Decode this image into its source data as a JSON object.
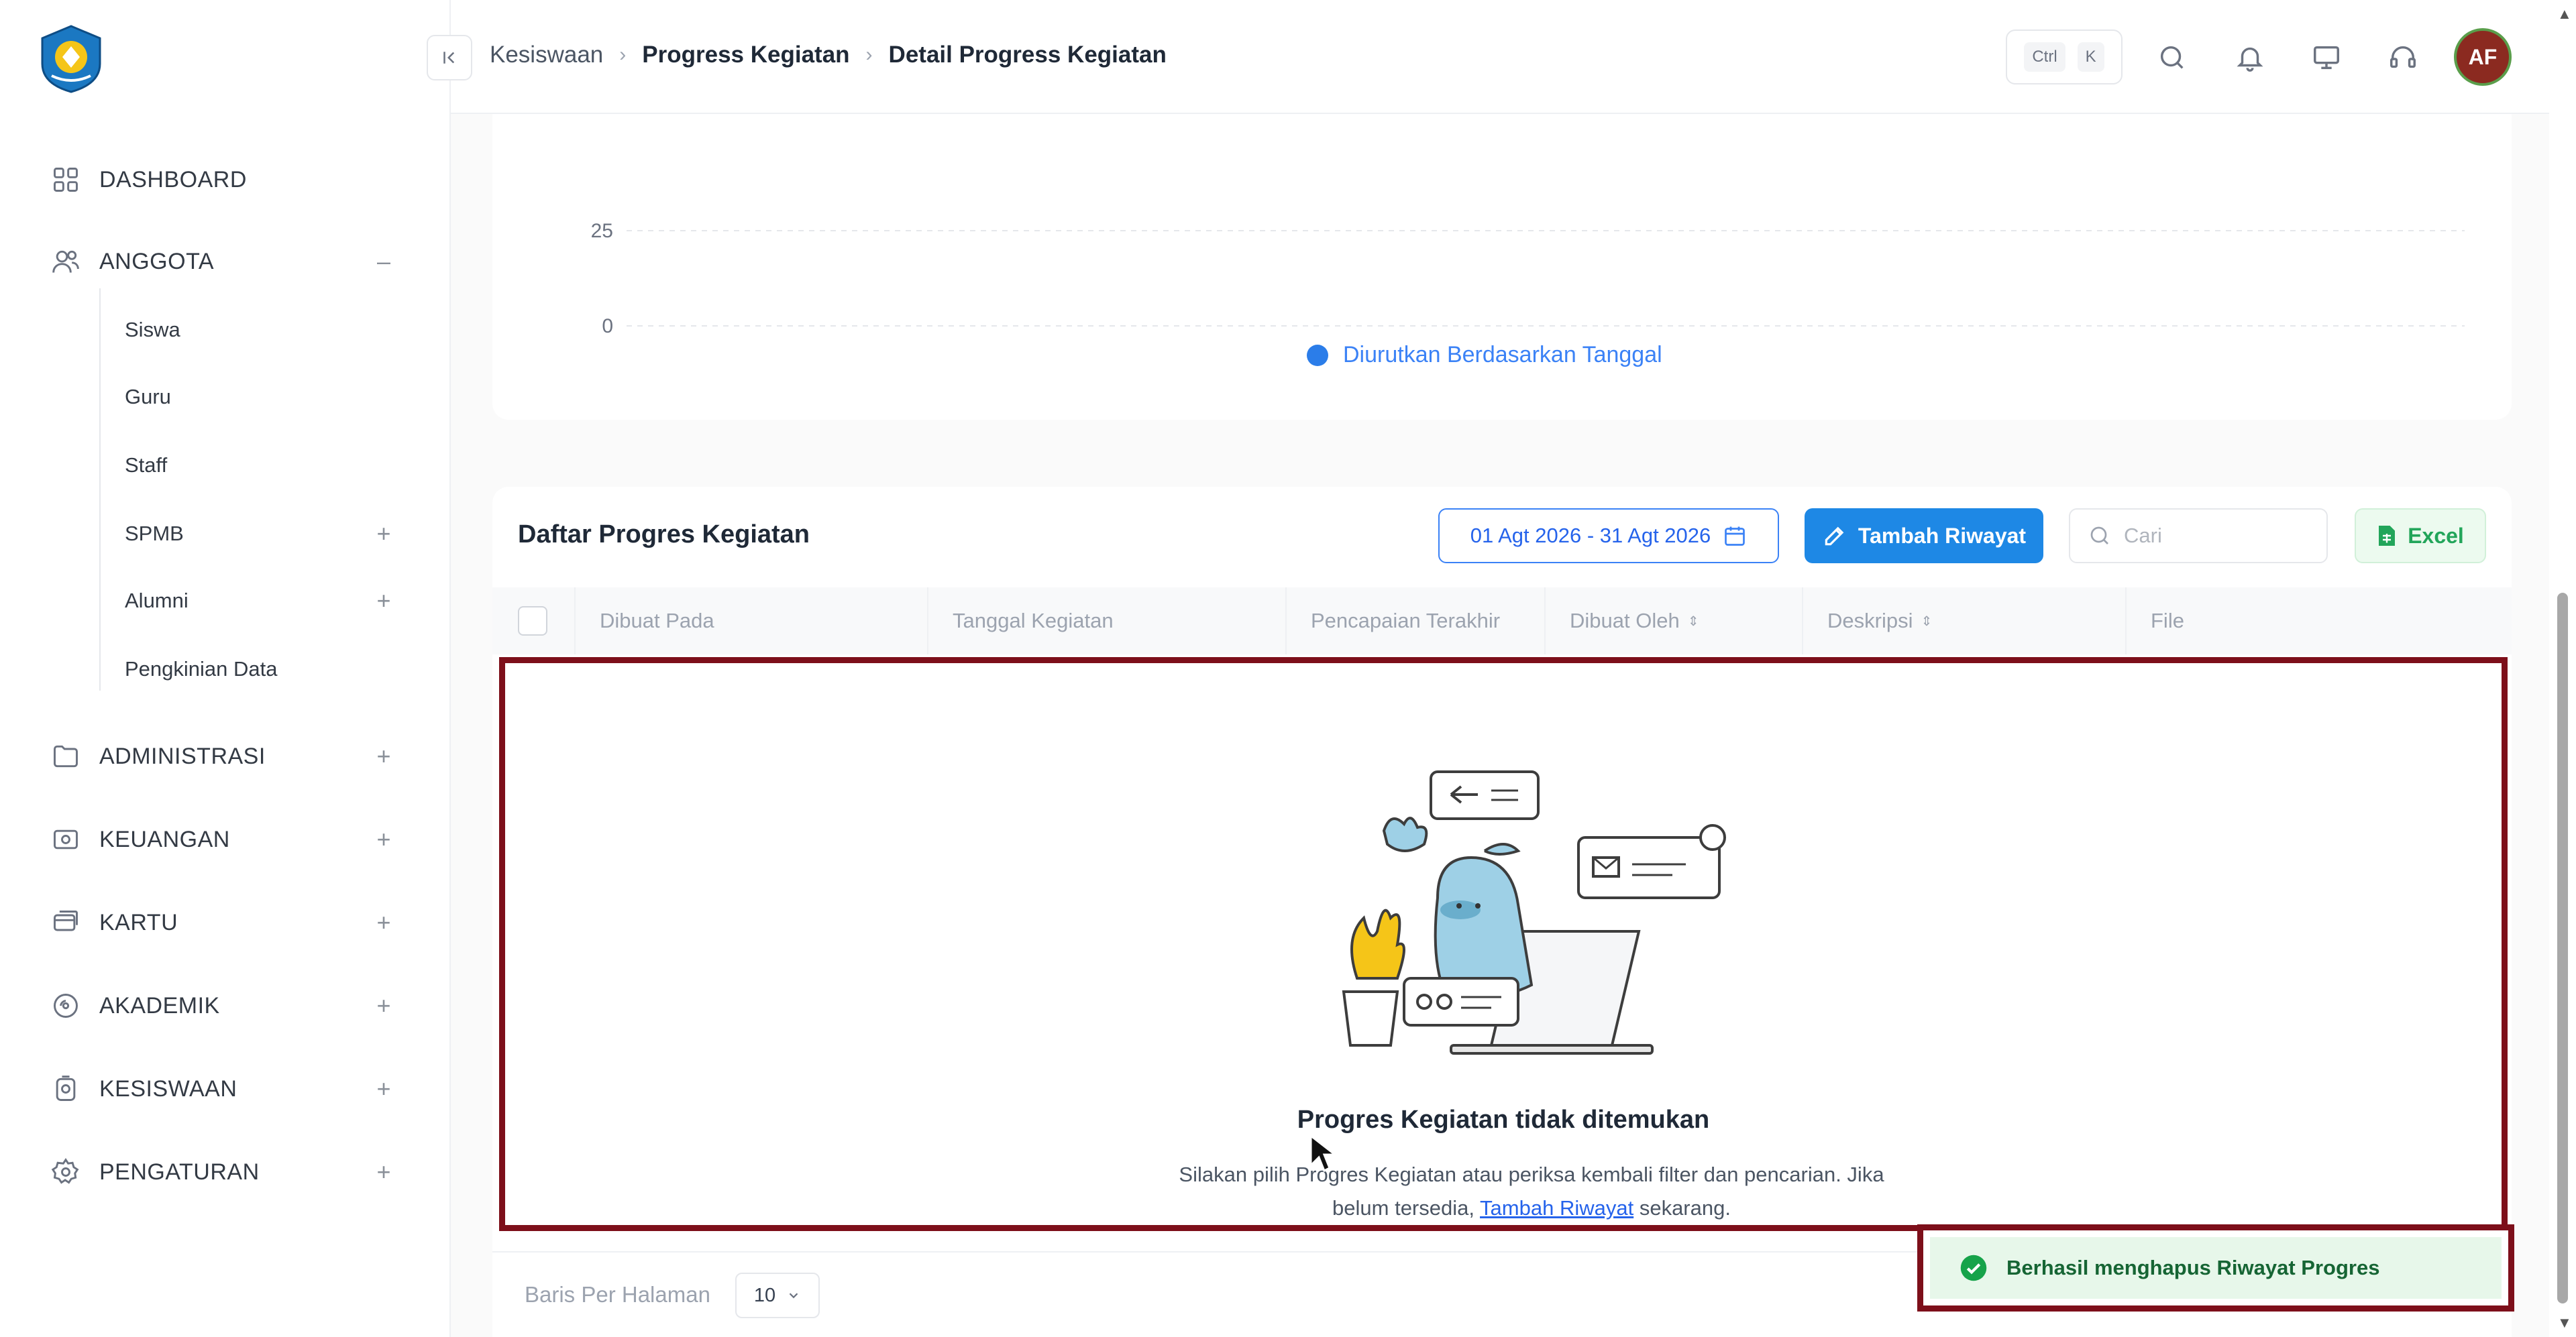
{
  "sidebar": {
    "items": [
      {
        "label": "DASHBOARD",
        "icon": "grid-icon"
      },
      {
        "label": "ANGGOTA",
        "icon": "users-icon",
        "toggle": "–"
      },
      {
        "label": "ADMINISTRASI",
        "icon": "folder-icon",
        "toggle": "+"
      },
      {
        "label": "KEUANGAN",
        "icon": "money-icon",
        "toggle": "+"
      },
      {
        "label": "KARTU",
        "icon": "card-icon",
        "toggle": "+"
      },
      {
        "label": "AKADEMIK",
        "icon": "academic-icon",
        "toggle": "+"
      },
      {
        "label": "KESISWAAN",
        "icon": "student-icon",
        "toggle": "+"
      },
      {
        "label": "PENGATURAN",
        "icon": "gear-icon",
        "toggle": "+"
      }
    ],
    "anggota_sub": [
      {
        "label": "Siswa"
      },
      {
        "label": "Guru"
      },
      {
        "label": "Staff"
      },
      {
        "label": "SPMB",
        "toggle": "+"
      },
      {
        "label": "Alumni",
        "toggle": "+"
      },
      {
        "label": "Pengkinian Data"
      }
    ]
  },
  "header": {
    "breadcrumb": [
      "Kesiswaan",
      "Progress Kegiatan",
      "Detail Progress Kegiatan"
    ],
    "kbd_ctrl": "Ctrl",
    "kbd_k": "K",
    "avatar_initials": "AF",
    "avatar_color": "#8b2a20"
  },
  "chart_data": {
    "type": "bar",
    "y_ticks": [
      "25",
      "0"
    ],
    "legend": [
      {
        "name": "Diurutkan Berdasarkan Tanggal",
        "color": "#2b7de9"
      }
    ],
    "categories": [],
    "values": []
  },
  "table": {
    "title": "Daftar Progres Kegiatan",
    "date_range": "01 Agt 2026 - 31 Agt 2026",
    "add_button": "Tambah Riwayat",
    "search_placeholder": "Cari",
    "excel_button": "Excel",
    "columns": [
      "Dibuat Pada",
      "Tanggal Kegiatan",
      "Pencapaian Terakhir",
      "Dibuat Oleh",
      "Deskripsi",
      "File"
    ],
    "empty_title": "Progres Kegiatan tidak ditemukan",
    "empty_desc_1": "Silakan pilih Progres Kegiatan atau periksa kembali filter dan pencarian. Jika belum tersedia,",
    "empty_link": "Tambah Riwayat",
    "empty_desc_2": "sekarang.",
    "per_page_label": "Baris Per Halaman",
    "per_page_value": "10"
  },
  "toast": {
    "message": "Berhasil menghapus Riwayat Progres",
    "color": "#16a34a"
  },
  "colors": {
    "accent": "#1e88e5",
    "highlight_border": "#7d0f1a"
  }
}
